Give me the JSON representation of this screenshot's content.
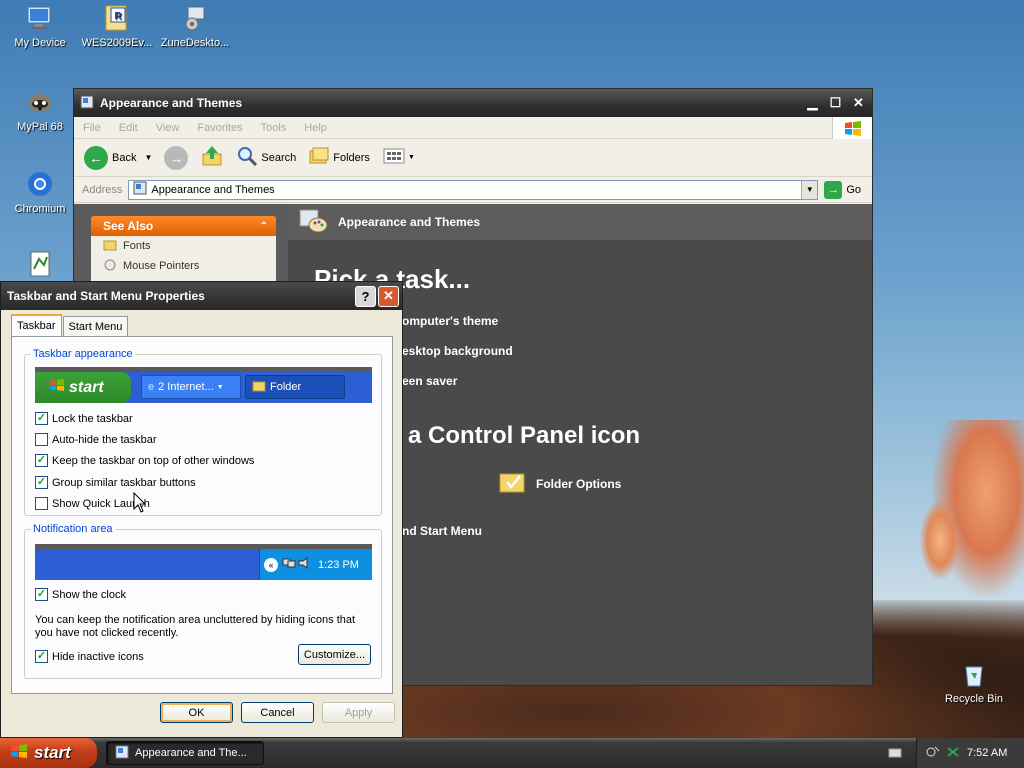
{
  "desktop": {
    "icons": [
      {
        "label": "My Device"
      },
      {
        "label": "WES2009Ev..."
      },
      {
        "label": "ZuneDeskto..."
      },
      {
        "label": "MyPal 68"
      },
      {
        "label": "Chromium"
      },
      {
        "label": "Recycle Bin"
      }
    ],
    "r_badge": "R"
  },
  "explorer": {
    "title": "Appearance and Themes",
    "menu": [
      "File",
      "Edit",
      "View",
      "Favorites",
      "Tools",
      "Help"
    ],
    "toolbar": {
      "back": "Back",
      "search": "Search",
      "folders": "Folders"
    },
    "address_label": "Address",
    "address_value": "Appearance and Themes",
    "go": "Go",
    "see_also": "See Also",
    "see_also_items": [
      "Fonts",
      "Mouse Pointers"
    ],
    "header": "Appearance and Themes",
    "pick_task": "Pick a task...",
    "tasks": [
      "omputer's theme",
      "esktop background",
      "een saver"
    ],
    "pick_icon": "a Control Panel icon",
    "icons": [
      "Folder Options",
      "nd Start Menu"
    ]
  },
  "dialog": {
    "title": "Taskbar and Start Menu Properties",
    "help": "?",
    "tabs": [
      "Taskbar",
      "Start Menu"
    ],
    "group1": "Taskbar appearance",
    "preview_start": "start",
    "preview_task1": "2 Internet...",
    "preview_task2": "Folder",
    "checks1": [
      {
        "label": "Lock the taskbar",
        "checked": true
      },
      {
        "label": "Auto-hide the taskbar",
        "checked": false
      },
      {
        "label": "Keep the taskbar on top of other windows",
        "checked": true
      },
      {
        "label": "Group similar taskbar buttons",
        "checked": true
      },
      {
        "label": "Show Quick Launch",
        "checked": false
      }
    ],
    "group2": "Notification area",
    "preview_time": "1:23 PM",
    "checks2": [
      {
        "label": "Show the clock",
        "checked": true
      },
      {
        "label": "Hide inactive icons",
        "checked": true
      }
    ],
    "notify_text": "You can keep the notification area uncluttered by hiding icons that you have not clicked recently.",
    "customize": "Customize...",
    "ok": "OK",
    "cancel": "Cancel",
    "apply": "Apply"
  },
  "taskbar": {
    "start": "start",
    "task": "Appearance and The...",
    "time": "7:52 AM"
  },
  "colors": {
    "accent_orange": "#e05e00",
    "xp_blue": "#245edb",
    "check_green": "#21a121"
  }
}
